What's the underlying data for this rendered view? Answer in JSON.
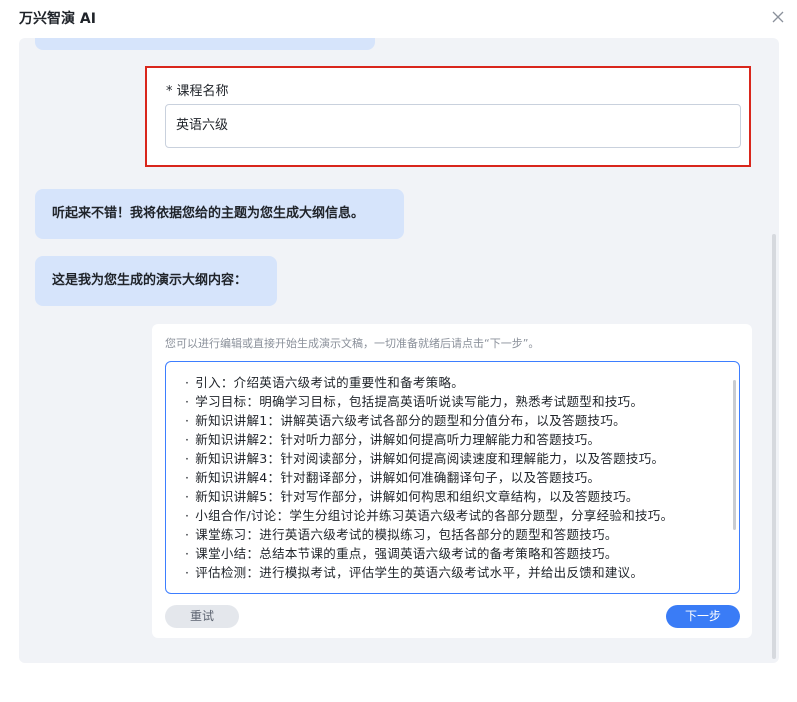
{
  "window": {
    "title": "万兴智演 AI",
    "close_icon": "close-icon"
  },
  "form": {
    "required_mark": "*",
    "label": "课程名称",
    "value": "英语六级"
  },
  "messages": [
    "听起来不错！我将依据您给的主题为您生成大纲信息。",
    "这是我为您生成的演示大纲内容："
  ],
  "outline": {
    "hint": "您可以进行编辑或直接开始生成演示文稿，一切准备就绪后请点击“下一步”。",
    "items": [
      "引入：介绍英语六级考试的重要性和备考策略。",
      "学习目标：明确学习目标，包括提高英语听说读写能力，熟悉考试题型和技巧。",
      "新知识讲解1：讲解英语六级考试各部分的题型和分值分布，以及答题技巧。",
      "新知识讲解2：针对听力部分，讲解如何提高听力理解能力和答题技巧。",
      "新知识讲解3：针对阅读部分，讲解如何提高阅读速度和理解能力，以及答题技巧。",
      "新知识讲解4：针对翻译部分，讲解如何准确翻译句子，以及答题技巧。",
      "新知识讲解5：针对写作部分，讲解如何构思和组织文章结构，以及答题技巧。",
      "小组合作/讨论：学生分组讨论并练习英语六级考试的各部分题型，分享经验和技巧。",
      "课堂练习：进行英语六级考试的模拟练习，包括各部分的题型和答题技巧。",
      "课堂小结：总结本节课的重点，强调英语六级考试的备考策略和答题技巧。",
      "评估检测：进行模拟考试，评估学生的英语六级考试水平，并给出反馈和建议。"
    ]
  },
  "buttons": {
    "retry": "重试",
    "next": "下一步"
  },
  "colors": {
    "accent": "#3a7cf6",
    "bubble": "#d6e4fb",
    "highlight_border": "#d9261c",
    "panel_bg": "#f1f3f7"
  }
}
